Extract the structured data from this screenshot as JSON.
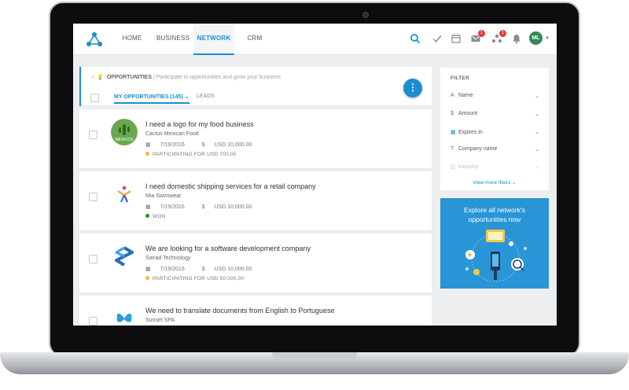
{
  "nav": {
    "tabs": [
      {
        "label": "HOME"
      },
      {
        "label": "BUSINESS"
      },
      {
        "label": "NETWORK"
      },
      {
        "label": "CRM"
      }
    ],
    "badges": {
      "mail": "1",
      "network": "1"
    },
    "avatar_initials": "ML"
  },
  "header": {
    "section": "OPPORTUNITIES",
    "separator": "|",
    "description": "Participate in opportunities and grow your business",
    "tabs": {
      "my_opportunities": "MY OPPORTUNITIES (145)",
      "leads": "LEADS"
    }
  },
  "opportunities": [
    {
      "title": "I need a logo for my food business",
      "company": "Cactus Mexican Food",
      "date": "7/19/2016",
      "amount": "USD 10,000.00",
      "status": "PARTICIPATING FOR USD 700,00",
      "status_color": "#f5b742",
      "logo_text": "MEXICOS"
    },
    {
      "title": "I need domestic shipping services for a retail company",
      "company": "Mia Swimwear",
      "date": "7/19/2016",
      "amount": "USD 10,000.00",
      "status": "WON",
      "status_color": "#2e8b2e"
    },
    {
      "title": "We are looking for a software development company",
      "company": "Sierad Technology",
      "date": "7/19/2016",
      "amount": "USD 10,000.00",
      "status": "PARTICIPATING FOR USD 50.000,00",
      "status_color": "#f5b742"
    },
    {
      "title": "We need to translate documents from English to Portuguese",
      "company": "Sunset SPA"
    }
  ],
  "filter": {
    "title": "FILTER",
    "rows": [
      {
        "label": "Name",
        "icon": "A"
      },
      {
        "label": "Amount",
        "icon": "$"
      },
      {
        "label": "Expires in",
        "icon": "▦"
      },
      {
        "label": "Company name",
        "icon": "T"
      },
      {
        "label": "Industry",
        "icon": "▥"
      }
    ],
    "more": "View more filters ⌄"
  },
  "promo": {
    "text": "Explore all network's opportunities now"
  },
  "colors": {
    "accent": "#1a8fcf",
    "promo_bg": "#2a95d6",
    "avatar": "#2e8b57",
    "badge": "#e53935"
  }
}
